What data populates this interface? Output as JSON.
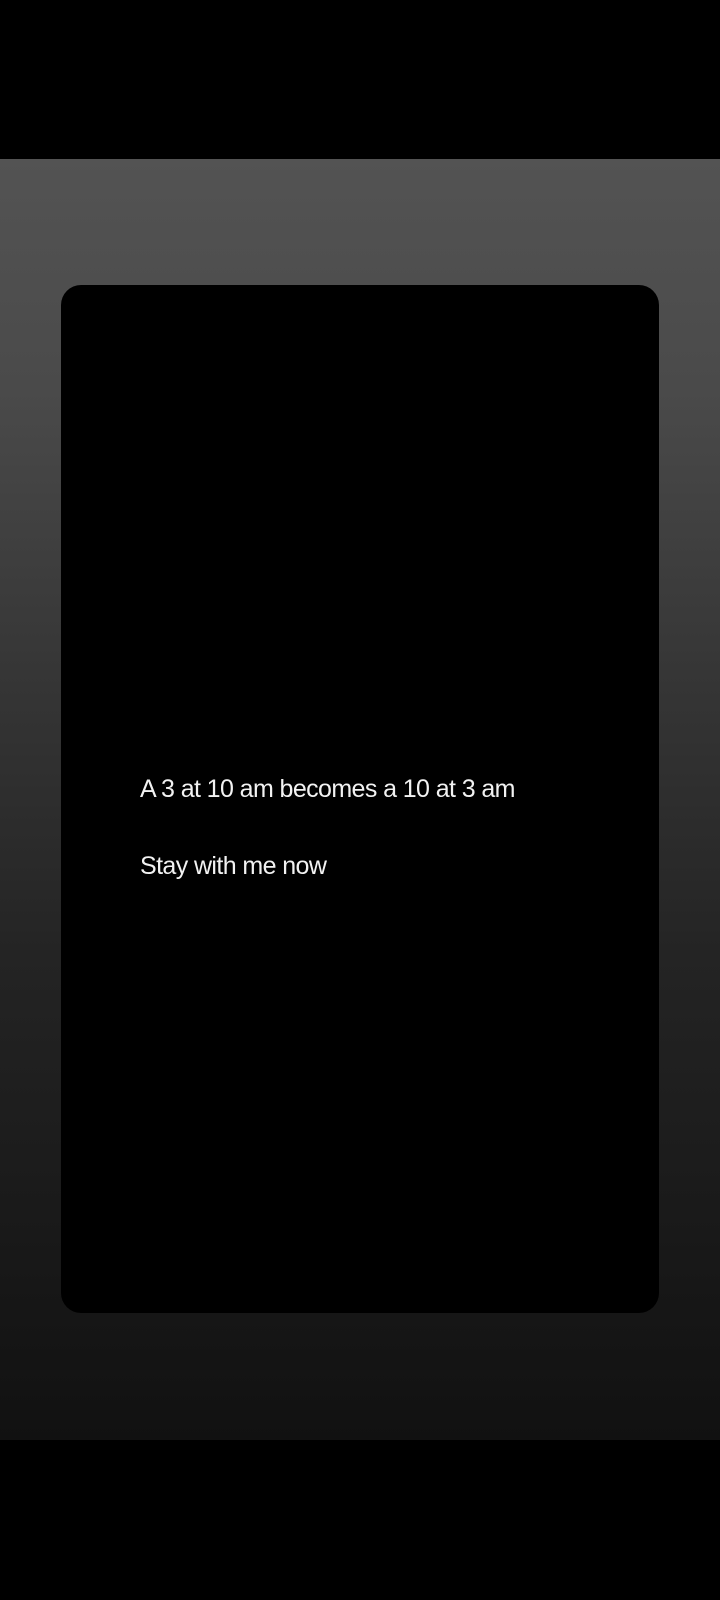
{
  "note": {
    "line_1": "A 3 at 10 am becomes a 10 at 3 am",
    "line_2": "Stay with me now"
  },
  "colors": {
    "backdrop_top": "#535353",
    "backdrop_bottom": "#111111",
    "card": "#000000",
    "text": "#f2f2f2"
  }
}
